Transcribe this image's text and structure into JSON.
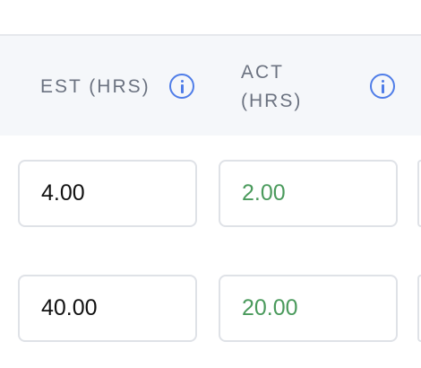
{
  "table": {
    "columns": [
      {
        "label": "EST (HRS)",
        "info_icon": "info-icon"
      },
      {
        "label": "ACT\n(HRS)",
        "info_icon": "info-icon"
      }
    ],
    "rows": [
      {
        "est": "4.00",
        "act": "2.00"
      },
      {
        "est": "40.00",
        "act": "20.00"
      }
    ]
  },
  "colors": {
    "header_bg": "#f5f7fa",
    "header_text": "#6b7280",
    "info_icon": "#4f7de8",
    "act_value": "#4a9a5c",
    "est_value": "#111111",
    "input_border": "#dfe2e7"
  }
}
